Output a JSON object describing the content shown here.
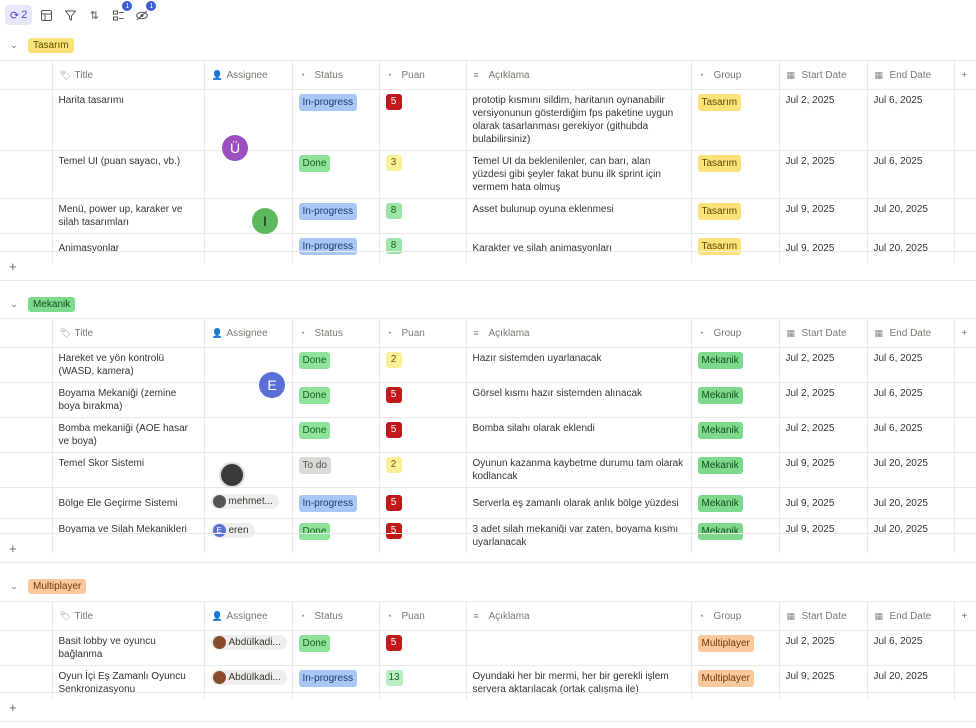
{
  "toolbar": {
    "sync_count": "2",
    "filter_badge": "1",
    "hide_badge": "1"
  },
  "headers": {
    "title": "Title",
    "assignee": "Assignee",
    "status": "Status",
    "puan": "Puan",
    "aciklama": "Açıklama",
    "group": "Group",
    "start": "Start Date",
    "end": "End Date"
  },
  "add_symbol": "+",
  "groups": [
    {
      "name": "Tasarım",
      "rows": [
        {
          "title": "Harita tasarımı",
          "assignee": "",
          "status": "In-progress",
          "puan": "5",
          "aciklama": "prototip kısmını sildim, haritanın oynanabilir versiyonunun gösterdiğim fps paketine uygun olarak tasarlanması gerekiyor (githubda bulabilirsiniz)",
          "group": "Tasarım",
          "start": "Jul 2, 2025",
          "end": "Jul 6, 2025"
        },
        {
          "title": "Temel UI (puan sayacı, vb.)",
          "assignee": "",
          "status": "Done",
          "puan": "3",
          "aciklama": "Temel UI da beklenilenler, can barı, alan yüzdesi gibi şeyler fakat bunu ilk sprint için vermem hata olmuş",
          "group": "Tasarım",
          "start": "Jul 2, 2025",
          "end": "Jul 6, 2025"
        },
        {
          "title": "Menü, power up, karaker ve silah tasarımları",
          "assignee": "",
          "status": "In-progress",
          "puan": "8",
          "aciklama": "Asset bulunup oyuna eklenmesi",
          "group": "Tasarım",
          "start": "Jul 9, 2025",
          "end": "Jul 20, 2025"
        },
        {
          "title": "Animasyonlar",
          "assignee": "",
          "status": "In-progress",
          "puan": "8",
          "aciklama": "Karakter ve silah animasyonları",
          "group": "Tasarım",
          "start": "Jul 9, 2025",
          "end": "Jul 20, 2025"
        }
      ],
      "avatars": [
        "Ü",
        "I"
      ]
    },
    {
      "name": "Mekanik",
      "rows": [
        {
          "title": "Hareket ve yön kontrolü (WASD, kamera)",
          "assignee": "",
          "status": "Done",
          "puan": "2",
          "aciklama": "Hazır sistemden uyarlanacak",
          "group": "Mekanik",
          "start": "Jul 2, 2025",
          "end": "Jul 6, 2025"
        },
        {
          "title": "Boyama Mekaniği (zemine boya bırakma)",
          "assignee": "",
          "status": "Done",
          "puan": "5",
          "aciklama": "Görsel kısmı hazır sistemden alınacak",
          "group": "Mekanik",
          "start": "Jul 2, 2025",
          "end": "Jul 6, 2025"
        },
        {
          "title": "Bomba mekaniği (AOE hasar ve boya)",
          "assignee": "",
          "status": "Done",
          "puan": "5",
          "aciklama": "Bomba silahı olarak eklendi",
          "group": "Mekanik",
          "start": "Jul 2, 2025",
          "end": "Jul 6, 2025"
        },
        {
          "title": "Temel Skor Sistemi",
          "assignee": "",
          "status": "To do",
          "puan": "2",
          "aciklama": "Oyunun kazanma kaybetme durumu tam olarak kodlancak",
          "group": "Mekanik",
          "start": "Jul 9, 2025",
          "end": "Jul 20, 2025"
        },
        {
          "title": "Bölge Ele Geçirme Sistemi",
          "assignee": "mehmet...",
          "status": "In-progress",
          "puan": "5",
          "aciklama": "Serverla eş zamanlı olarak anlık bölge yüzdesi",
          "group": "Mekanik",
          "start": "Jul 9, 2025",
          "end": "Jul 20, 2025"
        },
        {
          "title": "Boyama ve Silah Mekanikleri",
          "assignee": "eren",
          "status": "Done",
          "puan": "5",
          "aciklama": "3 adet silah mekaniği var zaten, boyama kısmı uyarlanacak",
          "group": "Mekanik",
          "start": "Jul 9, 2025",
          "end": "Jul 20, 2025"
        }
      ],
      "avatars": [
        "E"
      ],
      "eren_initial": "E"
    },
    {
      "name": "Multiplayer",
      "rows": [
        {
          "title": "Basit lobby ve oyuncu bağlanma",
          "assignee": "Abdülkadi...",
          "status": "Done",
          "puan": "5",
          "aciklama": "",
          "group": "Multiplayer",
          "start": "Jul 2, 2025",
          "end": "Jul 6, 2025"
        },
        {
          "title": "Oyun İçi Eş Zamanlı Oyuncu Senkronizasyonu",
          "assignee": "Abdülkadi...",
          "status": "In-progress",
          "puan": "13",
          "aciklama": "Oyundaki her bir mermi, her bir gerekli işlem servera aktarılacak (ortak çalışma ile)",
          "group": "Multiplayer",
          "start": "Jul 9, 2025",
          "end": "Jul 20, 2025"
        }
      ]
    }
  ],
  "colors": {
    "tasarim": "#fbe37a",
    "mekanik": "#7ed98c",
    "multiplayer": "#f9c89c",
    "in_progress": "#a9c6f5",
    "done": "#8ee29a",
    "todo": "#dcdad6",
    "puan_red": "#c0181b"
  }
}
